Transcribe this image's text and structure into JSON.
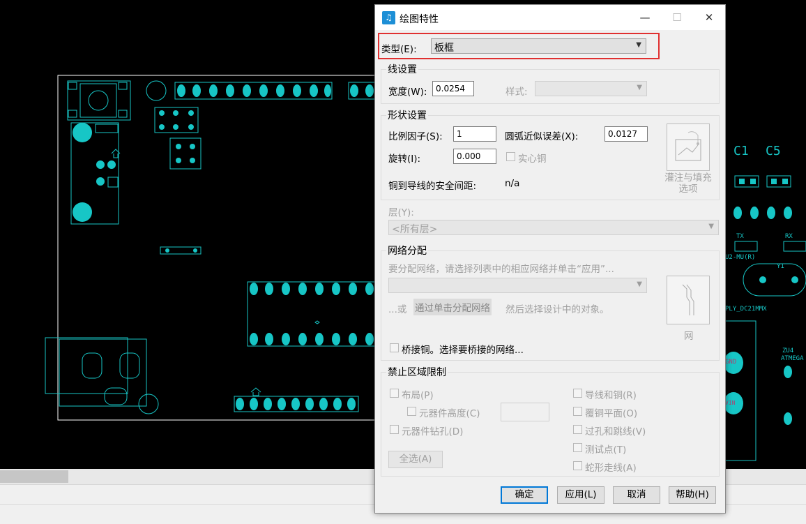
{
  "canvas": {
    "labels": {
      "c1": "C1",
      "c5": "C5",
      "tx": "TX",
      "rx": "RX",
      "u2": "U2-MU(R)",
      "y1": "Y1",
      "dc": "PLY_DC21MMX",
      "zu4": "ZU4",
      "atmega": "ATMEGA",
      "gnd": "GND",
      "vin": "VIN"
    }
  },
  "dialog": {
    "title": "绘图特性",
    "window_buttons": {
      "minimize": "—",
      "maximize": "☐",
      "close": "✕"
    },
    "type": {
      "label": "类型(E):",
      "value": "板框"
    },
    "line": {
      "group": "线设置",
      "width_label": "宽度(W):",
      "width_value": "0.0254",
      "style_label": "样式:",
      "style_value": ""
    },
    "shape": {
      "group": "形状设置",
      "scale_label": "比例因子(S):",
      "scale_value": "1",
      "arc_label": "圆弧近似误差(X):",
      "arc_value": "0.0127",
      "rotate_label": "旋转(I):",
      "rotate_value": "0.000",
      "solid_label": "实心铜",
      "clearance_label": "铜到导线的安全间距:",
      "clearance_value": "n/a",
      "fill_btn_label": "灌注与填充\n选项"
    },
    "layer": {
      "label": "层(Y):",
      "value": "<所有层>"
    },
    "net": {
      "group": "网络分配",
      "hint": "要分配网络，请选择列表中的相应网络并单击“应用”...",
      "combo_value": "",
      "or_text": "...或",
      "click_assign": "通过单击分配网络",
      "then_text": "然后选择设计中的对象。",
      "net_btn_label": "网",
      "bridge_label": "桥接铜。选择要桥接的网络..."
    },
    "keepout": {
      "group": "禁止区域限制",
      "left": [
        {
          "label": "布局(P)"
        },
        {
          "label": "元器件高度(C)"
        },
        {
          "label": "元器件钻孔(D)"
        }
      ],
      "right": [
        {
          "label": "导线和铜(R)"
        },
        {
          "label": "覆铜平面(O)"
        },
        {
          "label": "过孔和跳线(V)"
        },
        {
          "label": "测试点(T)"
        },
        {
          "label": "蛇形走线(A)"
        }
      ],
      "height_value": "",
      "select_all": "全选(A)"
    },
    "buttons": {
      "ok": "确定",
      "apply": "应用(L)",
      "cancel": "取消",
      "help": "帮助(H)"
    }
  },
  "colors": {
    "pcb": "#17c6c6",
    "canvas": "#000000",
    "dialog": "#f0f0f0",
    "highlight": "#e03030",
    "accent": "#0078d7"
  }
}
